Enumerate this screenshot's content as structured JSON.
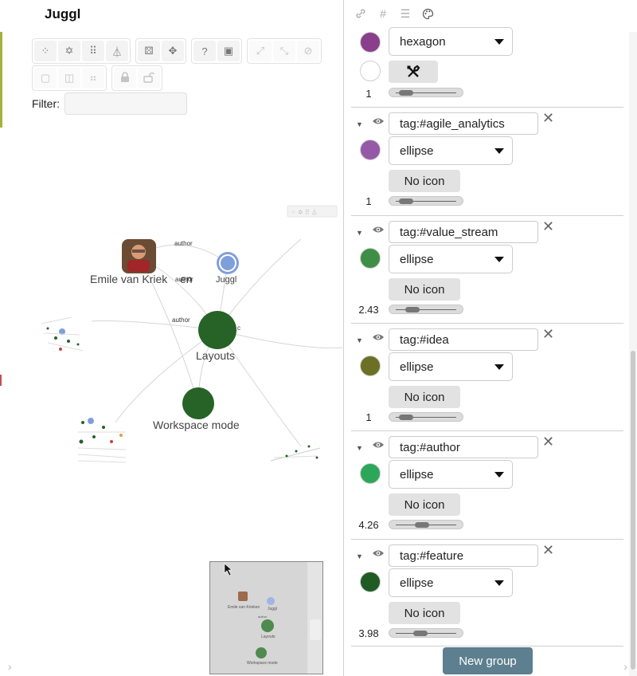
{
  "app": {
    "title": "Juggl"
  },
  "filter": {
    "label": "Filter:",
    "value": ""
  },
  "toolbar": {
    "row1": [
      {
        "name": "random-layout-icon",
        "glyph": "⁘"
      },
      {
        "name": "cose-layout-icon",
        "glyph": "✡"
      },
      {
        "name": "grid-layout-icon",
        "glyph": "⠿"
      },
      {
        "name": "hierarchy-layout-icon",
        "glyph": "⏃"
      },
      {
        "name": "dice-icon",
        "glyph": "⚄"
      },
      {
        "name": "fit-icon",
        "glyph": "✥"
      },
      {
        "name": "help-icon",
        "glyph": "?"
      },
      {
        "name": "save-icon",
        "glyph": "▣"
      },
      {
        "name": "expand-icon",
        "glyph": "⤢"
      },
      {
        "name": "collapse-icon",
        "glyph": "⤡"
      },
      {
        "name": "hide-icon",
        "glyph": "⊘"
      }
    ],
    "row2": [
      {
        "name": "select-all-icon",
        "glyph": "▢"
      },
      {
        "name": "invert-selection-icon",
        "glyph": "◫"
      },
      {
        "name": "select-neighbors-icon",
        "glyph": "⠶"
      },
      {
        "name": "lock-icon",
        "glyph": "🔒"
      },
      {
        "name": "unlock-icon",
        "glyph": "🔓"
      }
    ]
  },
  "graph": {
    "nodes": {
      "emile": "Emile van Kriek",
      "emile_overlap": "en",
      "juggl": "Juggl",
      "layouts": "Layouts",
      "workspace": "Workspace mode"
    },
    "edges": {
      "author1": "author",
      "author2": "author",
      "author3": "author",
      "edge_partial": "c"
    },
    "colors": {
      "dark_green": "#276227",
      "blue": "#7f9fdc"
    }
  },
  "minimap": {
    "labels": [
      "Emile van Krieken",
      "Juggl",
      "author",
      "Layouts",
      "Workspace mode"
    ]
  },
  "right_tabs": [
    {
      "name": "link-icon",
      "glyph": "🔗"
    },
    {
      "name": "hashtag-icon",
      "glyph": "#"
    },
    {
      "name": "list-icon",
      "glyph": "☰"
    },
    {
      "name": "palette-icon",
      "glyph": "🎨"
    }
  ],
  "groups_top": {
    "shape": "hexagon",
    "color": "#8a3f8c",
    "color2": "#ffffff",
    "size": "1"
  },
  "groups": [
    {
      "query": "tag:#agile_analytics",
      "shape": "ellipse",
      "color": "#9659a8",
      "icon_label": "No icon",
      "size": "1"
    },
    {
      "query": "tag:#value_stream",
      "shape": "ellipse",
      "color": "#3e8f45",
      "icon_label": "No icon",
      "size": "2.43"
    },
    {
      "query": "tag:#idea",
      "shape": "ellipse",
      "color": "#6b7024",
      "icon_label": "No icon",
      "size": "1"
    },
    {
      "query": "tag:#author",
      "shape": "ellipse",
      "color": "#2ca75a",
      "icon_label": "No icon",
      "size": "4.26"
    },
    {
      "query": "tag:#feature",
      "shape": "ellipse",
      "color": "#1f5b23",
      "icon_label": "No icon",
      "size": "3.98"
    }
  ],
  "new_group_label": "New group"
}
